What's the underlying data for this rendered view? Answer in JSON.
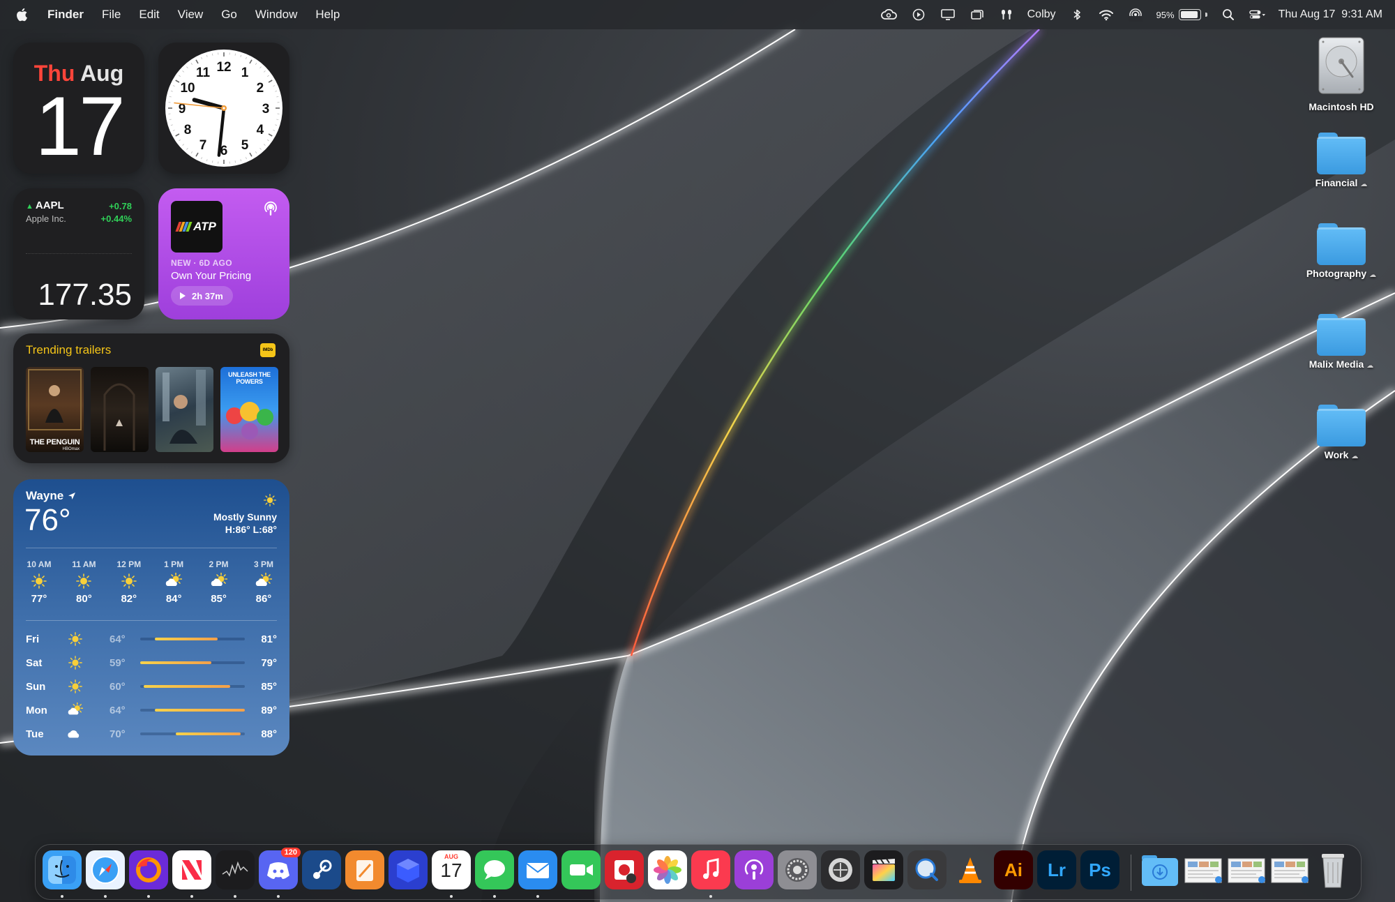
{
  "menubar": {
    "app_name": "Finder",
    "menus": [
      "File",
      "Edit",
      "View",
      "Go",
      "Window",
      "Help"
    ],
    "user": "Colby",
    "battery_percent": "95%",
    "datetime": "Thu Aug 17  9:31 AM",
    "status_icons": [
      "creative-cloud-icon",
      "play-icon",
      "display-icon",
      "screen-mirroring-icon",
      "airpods-icon",
      "bluetooth-icon",
      "wifi-icon",
      "airdrop-icon",
      "battery-icon",
      "spotlight-icon",
      "control-center-icon"
    ]
  },
  "widgets": {
    "calendar": {
      "weekday": "Thu",
      "month": "Aug",
      "day": "17"
    },
    "clock": {
      "hour_numbers": [
        "12",
        "1",
        "2",
        "3",
        "4",
        "5",
        "6",
        "7",
        "8",
        "9",
        "10",
        "11"
      ],
      "time": "9:31"
    },
    "stock": {
      "symbol": "AAPL",
      "name": "Apple Inc.",
      "change": "+0.78",
      "change_percent": "+0.44%",
      "price": "177.35",
      "color_up": "#30d158"
    },
    "podcast": {
      "show_art_text": "ATP",
      "meta": "NEW · 6D AGO",
      "episode": "Own Your Pricing",
      "duration": "2h 37m"
    },
    "trailers": {
      "title": "Trending trailers",
      "badge": "IMDb",
      "posters": [
        {
          "title": "THE PENGUIN",
          "network": "HBOmax"
        },
        {
          "title": "",
          "network": ""
        },
        {
          "title": "",
          "network": ""
        },
        {
          "title": "UNLEASH THE POWERS",
          "network": ""
        }
      ]
    },
    "weather": {
      "location": "Wayne",
      "temp": "76°",
      "condition": "Mostly Sunny",
      "high_low": "H:86° L:68°",
      "hourly": [
        {
          "time": "10 AM",
          "icon": "sun-icon",
          "temp": "77°"
        },
        {
          "time": "11 AM",
          "icon": "sun-icon",
          "temp": "80°"
        },
        {
          "time": "12 PM",
          "icon": "sun-icon",
          "temp": "82°"
        },
        {
          "time": "1 PM",
          "icon": "partly-cloudy-icon",
          "temp": "84°"
        },
        {
          "time": "2 PM",
          "icon": "partly-cloudy-icon",
          "temp": "85°"
        },
        {
          "time": "3 PM",
          "icon": "partly-cloudy-icon",
          "temp": "86°"
        }
      ],
      "daily": [
        {
          "day": "Fri",
          "icon": "sun-icon",
          "low": "64°",
          "high": "81°",
          "range": [
            0.14,
            0.74
          ]
        },
        {
          "day": "Sat",
          "icon": "sun-icon",
          "low": "59°",
          "high": "79°",
          "range": [
            0.0,
            0.68
          ]
        },
        {
          "day": "Sun",
          "icon": "sun-icon",
          "low": "60°",
          "high": "85°",
          "range": [
            0.03,
            0.86
          ]
        },
        {
          "day": "Mon",
          "icon": "partly-cloudy-icon",
          "low": "64°",
          "high": "89°",
          "range": [
            0.14,
            1.0
          ]
        },
        {
          "day": "Tue",
          "icon": "cloud-icon",
          "low": "70°",
          "high": "88°",
          "range": [
            0.34,
            0.96
          ]
        }
      ]
    }
  },
  "desktop_items": [
    {
      "label": "Macintosh HD",
      "kind": "disk",
      "icloud": false
    },
    {
      "label": "Financial",
      "kind": "folder",
      "icloud": true
    },
    {
      "label": "Photography",
      "kind": "folder",
      "icloud": true
    },
    {
      "label": "Malix Media",
      "kind": "folder",
      "icloud": true
    },
    {
      "label": "Work",
      "kind": "folder",
      "icloud": true
    }
  ],
  "dock": {
    "apps": [
      {
        "name": "finder-icon",
        "label": "",
        "bg": "#3aa0f5",
        "running": true
      },
      {
        "name": "safari-icon",
        "label": "",
        "bg": "#eaf3ff",
        "running": true
      },
      {
        "name": "firefox-icon",
        "label": "",
        "bg": "#6b2bd9",
        "running": true
      },
      {
        "name": "news-icon",
        "label": "",
        "bg": "#ffffff",
        "running": true
      },
      {
        "name": "stocks-icon",
        "label": "",
        "bg": "#1c1c1e",
        "running": true
      },
      {
        "name": "discord-icon",
        "label": "",
        "bg": "#5865f2",
        "running": true,
        "badge": "120"
      },
      {
        "name": "steam-icon",
        "label": "",
        "bg": "#1b4a8a",
        "running": false
      },
      {
        "name": "pages-icon",
        "label": "",
        "bg": "#f28a2e",
        "running": false
      },
      {
        "name": "box-icon",
        "label": "",
        "bg": "#2b3fcf",
        "running": false
      },
      {
        "name": "calendar-icon",
        "label": "17",
        "bg": "#ffffff",
        "running": true,
        "month": "AUG"
      },
      {
        "name": "messages-icon",
        "label": "",
        "bg": "#34c759",
        "running": true
      },
      {
        "name": "mail-icon",
        "label": "",
        "bg": "#2a8cf0",
        "running": true
      },
      {
        "name": "facetime-icon",
        "label": "",
        "bg": "#34c759",
        "running": false
      },
      {
        "name": "photo-booth-icon",
        "label": "",
        "bg": "#d9232d",
        "running": false
      },
      {
        "name": "photos-icon",
        "label": "",
        "bg": "#ffffff",
        "running": false
      },
      {
        "name": "music-icon",
        "label": "",
        "bg": "#fb3a4f",
        "running": true
      },
      {
        "name": "podcasts-icon",
        "label": "",
        "bg": "#9b3fd8",
        "running": false
      },
      {
        "name": "system-settings-icon",
        "label": "",
        "bg": "#8e8e93",
        "running": false
      },
      {
        "name": "compressor-icon",
        "label": "",
        "bg": "#2c2c2e",
        "running": false
      },
      {
        "name": "final-cut-icon",
        "label": "",
        "bg": "#1c1c1e",
        "running": false
      },
      {
        "name": "quicktime-icon",
        "label": "",
        "bg": "#3a3a3c",
        "running": false
      },
      {
        "name": "vlc-icon",
        "label": "",
        "bg": "transparent",
        "running": false
      },
      {
        "name": "illustrator-icon",
        "label": "Ai",
        "bg": "#330000",
        "fg": "#ff9a00",
        "running": false
      },
      {
        "name": "lightroom-icon",
        "label": "Lr",
        "bg": "#001e36",
        "fg": "#31a8ff",
        "running": false
      },
      {
        "name": "photoshop-icon",
        "label": "Ps",
        "bg": "#001e36",
        "fg": "#31a8ff",
        "running": false
      }
    ],
    "stacks": [
      "downloads-folder-icon",
      "screenshot-stack-1",
      "screenshot-stack-2",
      "screenshot-stack-3",
      "trash-icon"
    ]
  }
}
